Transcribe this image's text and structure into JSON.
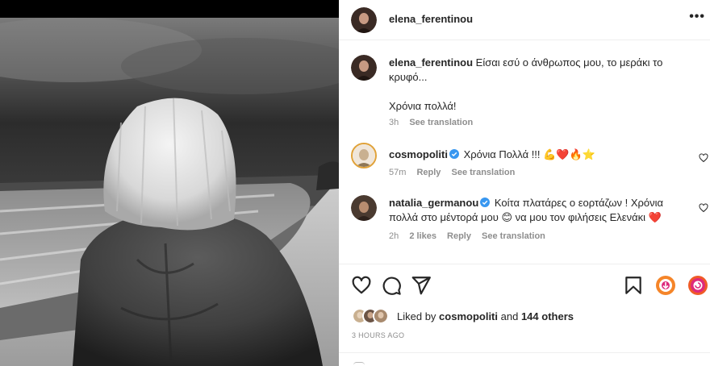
{
  "post": {
    "author": "elena_ferentinou",
    "caption_line1": "Είσαι εσύ ο άνθρωπος μου, το μεράκι το",
    "caption_line2": "κρυφό...",
    "caption_line3": "Χρόνια πολλά!",
    "caption_time": "3h",
    "caption_translate": "See translation"
  },
  "comments": [
    {
      "user": "cosmopoliti",
      "text": "Χρόνια Πολλά !!! 💪❤️🔥⭐",
      "time": "57m",
      "reply": "Reply",
      "translate": "See translation"
    },
    {
      "user": "natalia_germanou",
      "text_line1": "Κοίτα πλατάρες ο εορτάζων ! Χρόνια",
      "text_line2": "πολλά στο μέντορά μου 😊 να μου τον φιλήσεις Ελενάκι ❤️",
      "time": "2h",
      "likes": "2 likes",
      "reply": "Reply",
      "translate": "See translation"
    }
  ],
  "likes": {
    "prefix": "Liked by",
    "user": "cosmopoliti",
    "conj": "and",
    "others": "144 others"
  },
  "timestamp": "3 HOURS AGO",
  "icons": [
    "more-icon",
    "heart-icon",
    "comment-icon",
    "share-icon",
    "bookmark-icon",
    "verified-icon"
  ],
  "colors": {
    "text": "#262626",
    "muted": "#8e8e8e",
    "verified": "#3897f0",
    "heart_red": "#ed4956",
    "divider": "#efefef"
  }
}
